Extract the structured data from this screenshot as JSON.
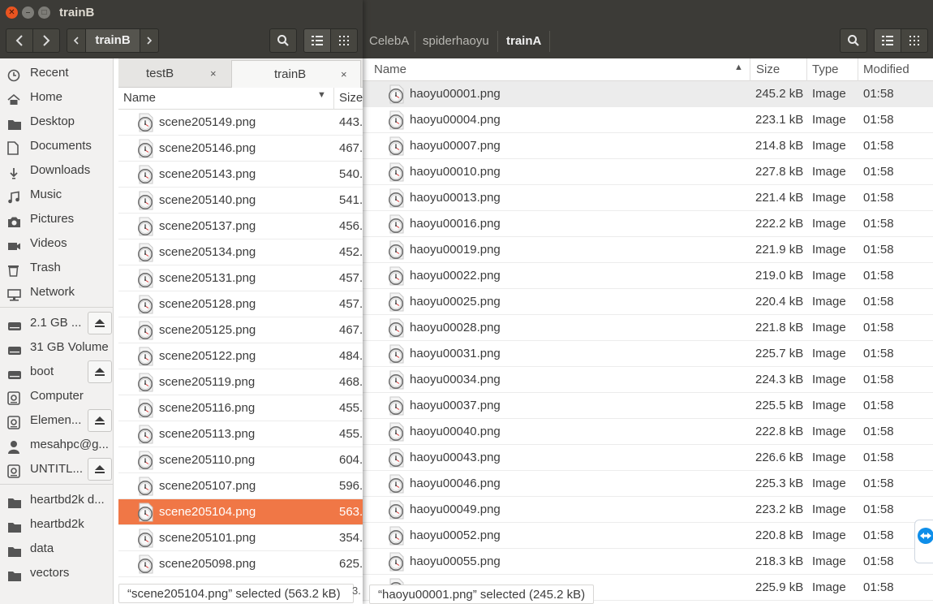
{
  "front_window": {
    "title": "trainB",
    "path_current": "trainB",
    "sidebar": {
      "places": [
        {
          "label": "Recent",
          "icon": "clock-icon"
        },
        {
          "label": "Home",
          "icon": "home-icon"
        },
        {
          "label": "Desktop",
          "icon": "folder-icon"
        },
        {
          "label": "Documents",
          "icon": "document-icon"
        },
        {
          "label": "Downloads",
          "icon": "download-icon"
        },
        {
          "label": "Music",
          "icon": "music-icon"
        },
        {
          "label": "Pictures",
          "icon": "camera-icon"
        },
        {
          "label": "Videos",
          "icon": "video-icon"
        },
        {
          "label": "Trash",
          "icon": "trash-icon"
        },
        {
          "label": "Network",
          "icon": "network-icon"
        }
      ],
      "devices": [
        {
          "label": "2.1 GB ...",
          "icon": "drive-icon",
          "eject": true
        },
        {
          "label": "31 GB Volume",
          "icon": "drive-icon",
          "eject": false
        },
        {
          "label": "boot",
          "icon": "drive-icon",
          "eject": true
        },
        {
          "label": "Computer",
          "icon": "computer-icon",
          "eject": false
        },
        {
          "label": "Elemen...",
          "icon": "computer-icon",
          "eject": true
        },
        {
          "label": "mesahpc@g...",
          "icon": "person-icon",
          "eject": false
        },
        {
          "label": "UNTITL...",
          "icon": "computer-icon",
          "eject": true
        }
      ],
      "bookmarks": [
        {
          "label": "heartbd2k d...",
          "icon": "folder-icon"
        },
        {
          "label": "heartbd2k",
          "icon": "folder-icon"
        },
        {
          "label": "data",
          "icon": "folder-icon"
        },
        {
          "label": "vectors",
          "icon": "folder-icon"
        }
      ]
    },
    "tabs": [
      {
        "label": "testB",
        "close": "×"
      },
      {
        "label": "trainB",
        "close": "×"
      }
    ],
    "columns": {
      "name": "Name",
      "size": "Size"
    },
    "files": [
      {
        "name": "scene205149.png",
        "size": "443."
      },
      {
        "name": "scene205146.png",
        "size": "467."
      },
      {
        "name": "scene205143.png",
        "size": "540."
      },
      {
        "name": "scene205140.png",
        "size": "541."
      },
      {
        "name": "scene205137.png",
        "size": "456."
      },
      {
        "name": "scene205134.png",
        "size": "452."
      },
      {
        "name": "scene205131.png",
        "size": "457."
      },
      {
        "name": "scene205128.png",
        "size": "457."
      },
      {
        "name": "scene205125.png",
        "size": "467."
      },
      {
        "name": "scene205122.png",
        "size": "484."
      },
      {
        "name": "scene205119.png",
        "size": "468."
      },
      {
        "name": "scene205116.png",
        "size": "455."
      },
      {
        "name": "scene205113.png",
        "size": "455."
      },
      {
        "name": "scene205110.png",
        "size": "604."
      },
      {
        "name": "scene205107.png",
        "size": "596."
      },
      {
        "name": "scene205104.png",
        "size": "563.",
        "selected": true
      },
      {
        "name": "scene205101.png",
        "size": "354."
      },
      {
        "name": "scene205098.png",
        "size": "625."
      }
    ],
    "status": "“scene205104.png” selected  (563.2 kB)",
    "status_tail": "3."
  },
  "back_window": {
    "breadcrumbs": [
      "CelebA",
      "spiderhaoyu",
      "trainA"
    ],
    "columns": {
      "name": "Name",
      "size": "Size",
      "type": "Type",
      "modified": "Modified"
    },
    "files": [
      {
        "name": "haoyu00001.png",
        "size": "245.2 kB",
        "type": "Image",
        "modified": "01:58",
        "selected": true
      },
      {
        "name": "haoyu00004.png",
        "size": "223.1 kB",
        "type": "Image",
        "modified": "01:58"
      },
      {
        "name": "haoyu00007.png",
        "size": "214.8 kB",
        "type": "Image",
        "modified": "01:58"
      },
      {
        "name": "haoyu00010.png",
        "size": "227.8 kB",
        "type": "Image",
        "modified": "01:58"
      },
      {
        "name": "haoyu00013.png",
        "size": "221.4 kB",
        "type": "Image",
        "modified": "01:58"
      },
      {
        "name": "haoyu00016.png",
        "size": "222.2 kB",
        "type": "Image",
        "modified": "01:58"
      },
      {
        "name": "haoyu00019.png",
        "size": "221.9 kB",
        "type": "Image",
        "modified": "01:58"
      },
      {
        "name": "haoyu00022.png",
        "size": "219.0 kB",
        "type": "Image",
        "modified": "01:58"
      },
      {
        "name": "haoyu00025.png",
        "size": "220.4 kB",
        "type": "Image",
        "modified": "01:58"
      },
      {
        "name": "haoyu00028.png",
        "size": "221.8 kB",
        "type": "Image",
        "modified": "01:58"
      },
      {
        "name": "haoyu00031.png",
        "size": "225.7 kB",
        "type": "Image",
        "modified": "01:58"
      },
      {
        "name": "haoyu00034.png",
        "size": "224.3 kB",
        "type": "Image",
        "modified": "01:58"
      },
      {
        "name": "haoyu00037.png",
        "size": "225.5 kB",
        "type": "Image",
        "modified": "01:58"
      },
      {
        "name": "haoyu00040.png",
        "size": "222.8 kB",
        "type": "Image",
        "modified": "01:58"
      },
      {
        "name": "haoyu00043.png",
        "size": "226.6 kB",
        "type": "Image",
        "modified": "01:58"
      },
      {
        "name": "haoyu00046.png",
        "size": "225.3 kB",
        "type": "Image",
        "modified": "01:58"
      },
      {
        "name": "haoyu00049.png",
        "size": "223.2 kB",
        "type": "Image",
        "modified": "01:58"
      },
      {
        "name": "haoyu00052.png",
        "size": "220.8 kB",
        "type": "Image",
        "modified": "01:58"
      },
      {
        "name": "haoyu00055.png",
        "size": "218.3 kB",
        "type": "Image",
        "modified": "01:58"
      },
      {
        "name": "",
        "size": "225.9 kB",
        "type": "Image",
        "modified": "01:58"
      }
    ],
    "status": "“haoyu00001.png” selected  (245.2 kB)"
  },
  "colors": {
    "titlebar": "#3c3b37",
    "selection": "#f07746",
    "close_button": "#e95420",
    "sidebar": "#f2f1f0"
  }
}
